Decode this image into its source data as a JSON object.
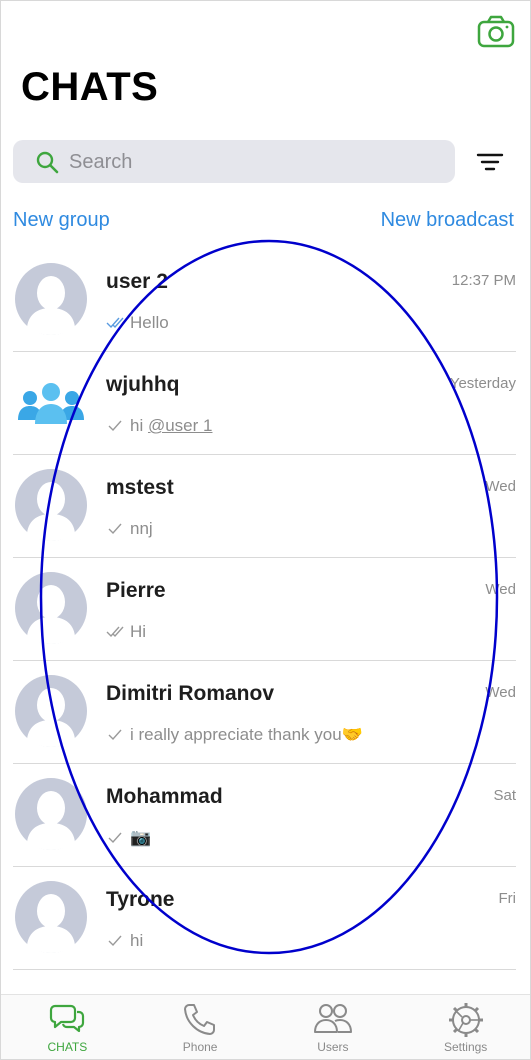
{
  "header": {
    "title": "CHATS",
    "camera_icon": "camera-icon"
  },
  "search": {
    "placeholder": "Search",
    "value": ""
  },
  "actions": {
    "new_group": "New group",
    "new_broadcast": "New broadcast"
  },
  "chats": [
    {
      "name": "user 2",
      "time": "12:37 PM",
      "status": "read",
      "message": "Hello",
      "avatar": "person"
    },
    {
      "name": "wjuhhq",
      "time": "Yesterday",
      "status": "sent",
      "message_prefix": "hi ",
      "mention": "@user 1",
      "avatar": "group"
    },
    {
      "name": "mstest",
      "time": "Wed",
      "status": "sent",
      "message": "nnj",
      "avatar": "person"
    },
    {
      "name": "Pierre",
      "time": "Wed",
      "status": "read",
      "message": "Hi",
      "avatar": "person"
    },
    {
      "name": "Dimitri Romanov",
      "time": "Wed",
      "status": "sent",
      "message": "i really appreciate thank you🤝",
      "avatar": "person"
    },
    {
      "name": "Mohammad",
      "time": "Sat",
      "status": "sent",
      "message": "📷",
      "avatar": "person"
    },
    {
      "name": "Tyrone",
      "time": "Fri",
      "status": "sent",
      "message": "hi",
      "avatar": "person"
    }
  ],
  "tabs": [
    {
      "label": "CHATS",
      "icon": "chat-bubbles-icon",
      "active": true
    },
    {
      "label": "Phone",
      "icon": "phone-icon",
      "active": false
    },
    {
      "label": "Users",
      "icon": "users-icon",
      "active": false
    },
    {
      "label": "Settings",
      "icon": "settings-gear-icon",
      "active": false
    }
  ],
  "colors": {
    "accent_green": "#3ea63e",
    "link_blue": "#2f8ae0",
    "avatar_gray": "#c5cad9",
    "group_blue": "#3aa7e6",
    "annotation_oval": "#0000cc"
  }
}
